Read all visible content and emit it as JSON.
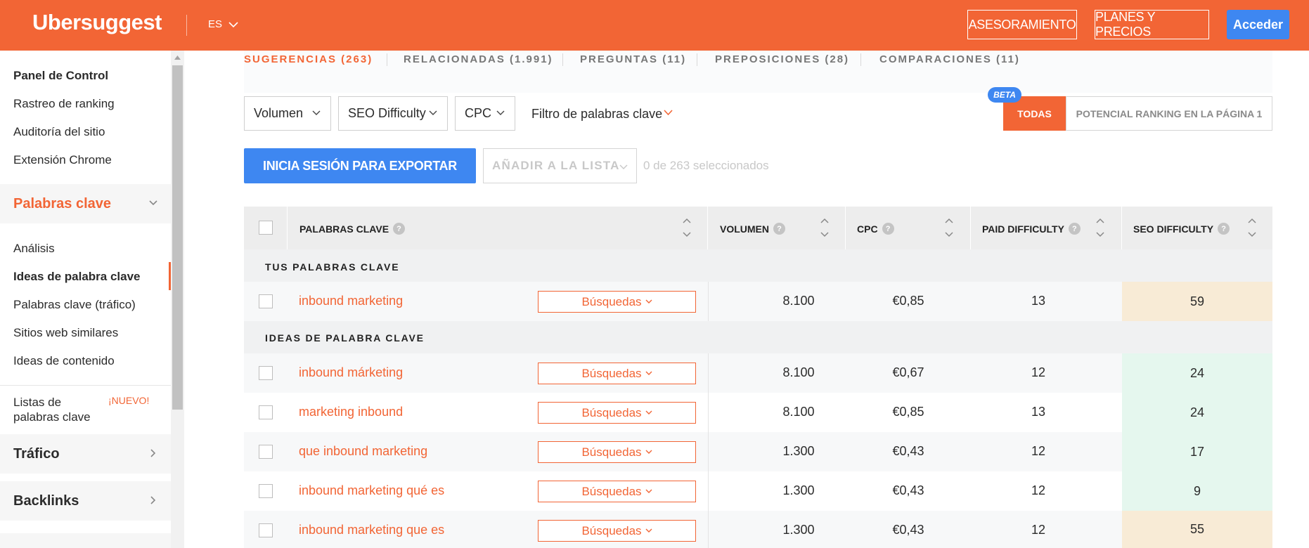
{
  "header": {
    "logo": "Ubersuggest",
    "lang": "ES",
    "btn_asesoramiento": "ASESORAMIENTO",
    "btn_planes": "PLANES Y PRECIOS",
    "btn_acceder": "Acceder"
  },
  "sidebar": {
    "panel": "Panel de Control",
    "rastreo": "Rastreo de ranking",
    "auditoria": "Auditoría del sitio",
    "extension": "Extensión Chrome",
    "palabras_section": "Palabras clave",
    "analisis": "Análisis",
    "ideas": "Ideas de palabra clave",
    "trafico_kw": "Palabras clave (tráfico)",
    "similares": "Sitios web similares",
    "contenido": "Ideas de contenido",
    "listas_line1": "Listas de",
    "listas_line2": "palabras clave",
    "nuevo": "¡NUEVO!",
    "trafico_section": "Tráfico",
    "backlinks_section": "Backlinks"
  },
  "tabs": {
    "sugerencias": "SUGERENCIAS (263)",
    "relacionadas": "RELACIONADAS (1.991)",
    "preguntas": "PREGUNTAS (11)",
    "preposiciones": "PREPOSICIONES (28)",
    "comparaciones": "COMPARACIONES (11)"
  },
  "filters": {
    "volumen": "Volumen",
    "seo": "SEO Difficulty",
    "cpc": "CPC",
    "keyword_filter": "Filtro de palabras clave",
    "beta": "BETA",
    "todas": "TODAS",
    "potencial": "POTENCIAL RANKING EN LA PÁGINA 1"
  },
  "actions": {
    "export": "INICIA SESIÓN PARA EXPORTAR",
    "add_list": "AÑADIR A LA LISTA",
    "selected": "0 de 263 seleccionados"
  },
  "table": {
    "headers": {
      "keywords": "PALABRAS CLAVE",
      "volumen": "VOLUMEN",
      "cpc": "CPC",
      "paid": "PAID DIFFICULTY",
      "seo": "SEO DIFFICULTY",
      "q": "?"
    },
    "group_own": "TUS PALABRAS CLAVE",
    "group_ideas": "IDEAS DE PALABRA CLAVE",
    "search_label": "Búsquedas",
    "rows": [
      {
        "keyword": "inbound marketing",
        "volume": "8.100",
        "cpc": "€0,85",
        "paid": "13",
        "seo": "59"
      },
      {
        "keyword": "inbound márketing",
        "volume": "8.100",
        "cpc": "€0,67",
        "paid": "12",
        "seo": "24"
      },
      {
        "keyword": "marketing inbound",
        "volume": "8.100",
        "cpc": "€0,85",
        "paid": "13",
        "seo": "24"
      },
      {
        "keyword": "que inbound marketing",
        "volume": "1.300",
        "cpc": "€0,43",
        "paid": "12",
        "seo": "17"
      },
      {
        "keyword": "inbound marketing qué es",
        "volume": "1.300",
        "cpc": "€0,43",
        "paid": "12",
        "seo": "9"
      },
      {
        "keyword": "inbound marketing que es",
        "volume": "1.300",
        "cpc": "€0,43",
        "paid": "12",
        "seo": "55"
      }
    ]
  },
  "colors": {
    "brand": "#f26535",
    "blue": "#3e87f1",
    "seo_high": "#f8ebd6",
    "seo_low": "#e5f7ee"
  }
}
